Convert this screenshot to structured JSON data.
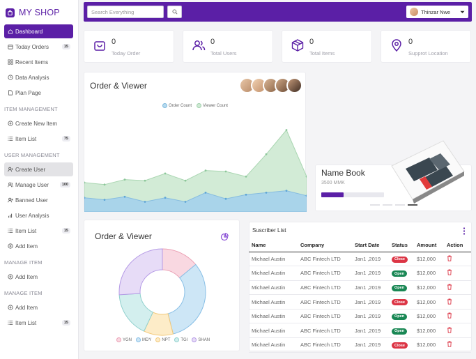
{
  "brand": {
    "name": "MY SHOP"
  },
  "sidebar": {
    "items": [
      {
        "label": "Dashboard",
        "icon": "home-icon",
        "active": true
      },
      {
        "label": "Today Orders",
        "icon": "calendar-icon",
        "badge": "15"
      },
      {
        "label": "Recent Items",
        "icon": "grid-icon"
      },
      {
        "label": "Data Analysis",
        "icon": "clock-icon"
      },
      {
        "label": "Plan Page",
        "icon": "file-icon"
      }
    ],
    "sections": [
      {
        "title": "ITEM MANAGEMENT",
        "items": [
          {
            "label": "Create New Item",
            "icon": "plus-circle-icon"
          },
          {
            "label": "Item List",
            "icon": "list-icon",
            "badge": "75"
          }
        ]
      },
      {
        "title": "USER MANAGEMENT",
        "items": [
          {
            "label": "Create User",
            "icon": "user-plus-icon",
            "hover": true
          },
          {
            "label": "Manage User",
            "icon": "users-icon",
            "badge": "100"
          },
          {
            "label": "Banned User",
            "icon": "user-x-icon"
          },
          {
            "label": "User Analysis",
            "icon": "bar-chart-icon"
          },
          {
            "label": "Item List",
            "icon": "list-icon",
            "badge": "15"
          },
          {
            "label": "Add Item",
            "icon": "plus-circle-icon"
          }
        ]
      },
      {
        "title": "MANAGE ITEM",
        "items": [
          {
            "label": "Add Item",
            "icon": "plus-circle-icon"
          }
        ]
      },
      {
        "title": "MANAGE ITEM",
        "items": [
          {
            "label": "Add Item",
            "icon": "plus-circle-icon"
          },
          {
            "label": "Item List",
            "icon": "list-icon",
            "badge": "15"
          }
        ]
      }
    ]
  },
  "topbar": {
    "search_placeholder": "Search Everything",
    "user_name": "Thinzar Nwe"
  },
  "stats": [
    {
      "value": "0",
      "label": "Today Order",
      "icon": "shopping-bag-icon"
    },
    {
      "value": "0",
      "label": "Total Users",
      "icon": "users-icon"
    },
    {
      "value": "0",
      "label": "Total Items",
      "icon": "box-icon"
    },
    {
      "value": "0",
      "label": "Supprot Location",
      "icon": "map-pin-icon"
    }
  ],
  "area_card": {
    "title": "Order & Viewer"
  },
  "name_book": {
    "title": "Name Book",
    "subtitle": "3500 MMK",
    "progress": 0.35
  },
  "donut_card": {
    "title": "Order & Viewer"
  },
  "table_card": {
    "title": "Suscriber List",
    "headers": [
      "Name",
      "Company",
      "Start Date",
      "Status",
      "Amount",
      "Action"
    ],
    "rows": [
      {
        "name": "Michael Austin",
        "company": "ABC Fintech LTD",
        "date": "Jan1 ,2019",
        "status": "Close",
        "amount": "$12,000"
      },
      {
        "name": "Michael Austin",
        "company": "ABC Fintech LTD",
        "date": "Jan1 ,2019",
        "status": "Open",
        "amount": "$12,000"
      },
      {
        "name": "Michael Austin",
        "company": "ABC Fintech LTD",
        "date": "Jan1 ,2019",
        "status": "Open",
        "amount": "$12,000"
      },
      {
        "name": "Michael Austin",
        "company": "ABC Fintech LTD",
        "date": "Jan1 ,2019",
        "status": "Close",
        "amount": "$12,000"
      },
      {
        "name": "Michael Austin",
        "company": "ABC Fintech LTD",
        "date": "Jan1 ,2019",
        "status": "Open",
        "amount": "$12,000"
      },
      {
        "name": "Michael Austin",
        "company": "ABC Fintech LTD",
        "date": "Jan1 ,2019",
        "status": "Open",
        "amount": "$12,000"
      },
      {
        "name": "Michael Austin",
        "company": "ABC Fintech LTD",
        "date": "Jan1 ,2019",
        "status": "Close",
        "amount": "$12,000"
      }
    ]
  },
  "colors": {
    "primary": "#5b1fa6",
    "close": "#dc3545",
    "open": "#198754"
  },
  "chart_data": [
    {
      "type": "area",
      "title": "Order & Viewer",
      "x": [
        1,
        2,
        3,
        4,
        5,
        6,
        7,
        8,
        9,
        10,
        11,
        12
      ],
      "ylim": [
        0,
        100
      ],
      "series": [
        {
          "name": "Order Count",
          "values": [
            14,
            12,
            15,
            10,
            14,
            10,
            19,
            13,
            17,
            19,
            21,
            16
          ]
        },
        {
          "name": "Viewer Count",
          "values": [
            29,
            27,
            32,
            31,
            38,
            31,
            41,
            40,
            35,
            57,
            81,
            35
          ]
        }
      ]
    },
    {
      "type": "pie",
      "title": "Order & Viewer",
      "categories": [
        "YGN",
        "MDY",
        "NPT",
        "TGI",
        "SHAN"
      ],
      "values": [
        14,
        32,
        11,
        17,
        26
      ]
    }
  ]
}
